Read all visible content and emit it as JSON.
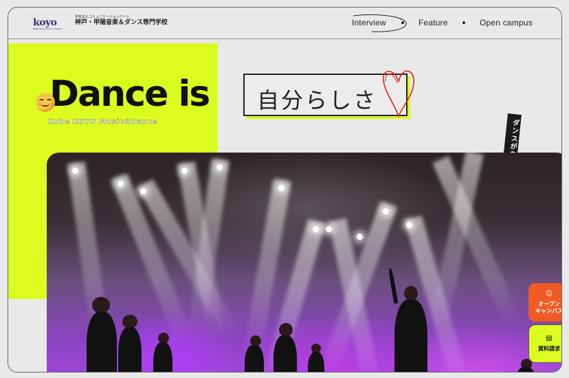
{
  "header": {
    "logo": "koyo",
    "logo_sub": "KOBE KOYO MUSIC & DANCE",
    "school_sub": "学校法人コミュニケーションアート",
    "school_name": "神戸・甲陽音楽＆ダンス専門学校",
    "nav": [
      {
        "label": "Interview"
      },
      {
        "label": "Feature"
      },
      {
        "label": "Open campus"
      }
    ]
  },
  "hero": {
    "headline": "Dance is",
    "handwritten": "自分らしさ",
    "tagline": "Kobe KOYO Music&Dance",
    "vertical_text": "ダンスがあって、私がいる"
  },
  "side_buttons": [
    {
      "label": "オープン\nキャンパス",
      "icon": "smile-emoji-icon"
    },
    {
      "label": "資料請求",
      "icon": "book-icon"
    }
  ],
  "colors": {
    "accent_lime": "#dcfc1f",
    "accent_orange": "#f15a24",
    "heart_red": "#e2231a",
    "brand_purple": "#3b2b78"
  }
}
